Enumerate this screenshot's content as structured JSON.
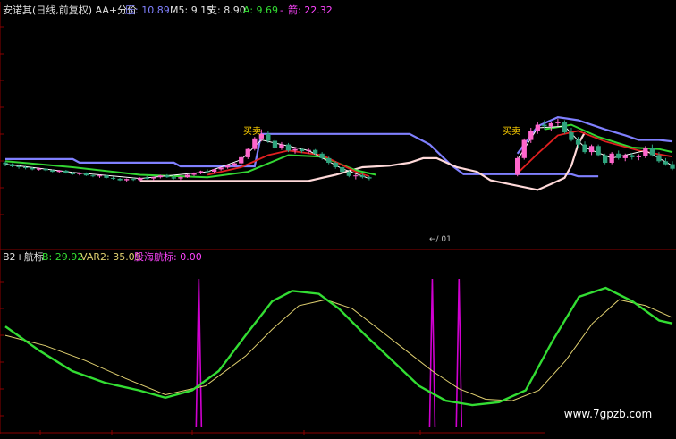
{
  "colors": {
    "bg": "#000000",
    "grid": "#8a0000",
    "up": "#ff66cc",
    "down": "#2fa37d",
    "ma5": "#ffffff",
    "ma_red": "#e02020",
    "ma_green": "#33d633",
    "resist": "#8080ff",
    "support": "#ffd9d9",
    "b_line": "#33dd33",
    "var2_line": "#e0d070",
    "signal": "#d000d0",
    "label_white": "#e0e0e0",
    "label_blue": "#8080ff",
    "label_yellow": "#e0d070",
    "label_green": "#33dd33",
    "label_magenta": "#ff44ff"
  },
  "upper_header": {
    "title": "安诺其(日线,前复权) AA+分价",
    "ya_label": "压: 10.89",
    "m5_label": "M5: 9.15",
    "zhi_label": "支: 8.90",
    "a_label": "A: 9.69",
    "dash": "-",
    "jian_label": "箭: 22.32"
  },
  "lower_header": {
    "title": "B2+航标",
    "b_label": "B: 29.92",
    "var2_label": "VAR2: 35.09",
    "signal_label": "股海航标: 0.00"
  },
  "annotations": {
    "buy1": "买卖",
    "buy2": "买卖",
    "arrow_label": "←/.01"
  },
  "watermark": "www.7gpzb.com",
  "chart_data": [
    {
      "type": "candlestick",
      "panel": "upper",
      "title": "安诺其(日线,前复权) AA+分价",
      "ylim": [
        7.8,
        11.4
      ],
      "x_count": 100,
      "candles": [
        [
          0,
          9.1,
          9.15,
          8.98,
          9.05
        ],
        [
          1,
          9.05,
          9.08,
          8.95,
          8.98
        ],
        [
          2,
          8.98,
          9.02,
          8.9,
          8.95
        ],
        [
          3,
          8.95,
          9.0,
          8.88,
          8.92
        ],
        [
          4,
          8.92,
          8.96,
          8.85,
          8.88
        ],
        [
          5,
          8.88,
          8.94,
          8.84,
          8.9
        ],
        [
          6,
          8.9,
          8.92,
          8.82,
          8.85
        ],
        [
          7,
          8.85,
          8.88,
          8.78,
          8.8
        ],
        [
          8,
          8.8,
          8.86,
          8.76,
          8.84
        ],
        [
          9,
          8.84,
          8.86,
          8.74,
          8.76
        ],
        [
          10,
          8.76,
          8.8,
          8.7,
          8.72
        ],
        [
          11,
          8.72,
          8.78,
          8.68,
          8.75
        ],
        [
          12,
          8.75,
          8.78,
          8.66,
          8.68
        ],
        [
          13,
          8.68,
          8.72,
          8.62,
          8.65
        ],
        [
          14,
          8.65,
          8.7,
          8.6,
          8.68
        ],
        [
          15,
          8.68,
          8.7,
          8.58,
          8.6
        ],
        [
          16,
          8.6,
          8.64,
          8.54,
          8.57
        ],
        [
          17,
          8.57,
          8.6,
          8.5,
          8.52
        ],
        [
          18,
          8.52,
          8.58,
          8.48,
          8.56
        ],
        [
          19,
          8.56,
          8.6,
          8.5,
          8.53
        ],
        [
          20,
          8.53,
          8.62,
          8.5,
          8.6
        ],
        [
          21,
          8.6,
          8.66,
          8.55,
          8.58
        ],
        [
          22,
          8.58,
          8.64,
          8.52,
          8.62
        ],
        [
          23,
          8.62,
          8.7,
          8.58,
          8.68
        ],
        [
          24,
          8.68,
          8.72,
          8.6,
          8.62
        ],
        [
          25,
          8.62,
          8.68,
          8.55,
          8.58
        ],
        [
          26,
          8.58,
          8.64,
          8.52,
          8.62
        ],
        [
          27,
          8.62,
          8.72,
          8.6,
          8.7
        ],
        [
          28,
          8.7,
          8.78,
          8.66,
          8.76
        ],
        [
          29,
          8.76,
          8.84,
          8.72,
          8.82
        ],
        [
          30,
          8.82,
          8.88,
          8.76,
          8.8
        ],
        [
          31,
          8.8,
          8.9,
          8.76,
          8.88
        ],
        [
          32,
          8.88,
          8.96,
          8.84,
          8.94
        ],
        [
          33,
          8.94,
          9.02,
          8.9,
          9.0
        ],
        [
          34,
          9.0,
          9.1,
          8.96,
          9.08
        ],
        [
          35,
          9.08,
          9.3,
          9.05,
          9.28
        ],
        [
          36,
          9.28,
          9.6,
          9.22,
          9.55
        ],
        [
          37,
          9.55,
          9.95,
          9.5,
          9.9
        ],
        [
          38,
          9.9,
          10.2,
          9.8,
          10.05
        ],
        [
          39,
          10.05,
          10.15,
          9.75,
          9.82
        ],
        [
          40,
          9.82,
          9.9,
          9.55,
          9.6
        ],
        [
          41,
          9.6,
          9.78,
          9.52,
          9.7
        ],
        [
          42,
          9.7,
          9.75,
          9.45,
          9.5
        ],
        [
          43,
          9.5,
          9.62,
          9.4,
          9.55
        ],
        [
          44,
          9.55,
          9.6,
          9.42,
          9.48
        ],
        [
          45,
          9.48,
          9.58,
          9.4,
          9.52
        ],
        [
          46,
          9.52,
          9.55,
          9.35,
          9.4
        ],
        [
          47,
          9.4,
          9.45,
          9.2,
          9.25
        ],
        [
          48,
          9.25,
          9.3,
          9.05,
          9.1
        ],
        [
          49,
          9.1,
          9.15,
          8.9,
          8.95
        ],
        [
          50,
          8.95,
          9.0,
          8.75,
          8.8
        ],
        [
          51,
          8.8,
          8.85,
          8.62,
          8.66
        ],
        [
          52,
          8.66,
          8.72,
          8.55,
          8.68
        ],
        [
          53,
          8.68,
          8.74,
          8.58,
          8.62
        ],
        [
          54,
          8.62,
          8.66,
          8.52,
          8.58
        ],
        [
          76,
          8.7,
          9.3,
          8.65,
          9.25
        ],
        [
          77,
          9.25,
          9.9,
          9.2,
          9.85
        ],
        [
          78,
          9.85,
          10.25,
          9.75,
          10.15
        ],
        [
          79,
          10.15,
          10.45,
          10.05,
          10.35
        ],
        [
          80,
          10.35,
          10.5,
          10.2,
          10.3
        ],
        [
          81,
          10.3,
          10.45,
          10.15,
          10.4
        ],
        [
          82,
          10.4,
          10.55,
          10.3,
          10.45
        ],
        [
          83,
          10.45,
          10.5,
          10.05,
          10.1
        ],
        [
          84,
          10.1,
          10.25,
          9.8,
          9.85
        ],
        [
          85,
          9.85,
          9.95,
          9.6,
          9.7
        ],
        [
          86,
          9.7,
          9.8,
          9.4,
          9.45
        ],
        [
          87,
          9.45,
          9.7,
          9.35,
          9.65
        ],
        [
          88,
          9.65,
          9.7,
          9.3,
          9.35
        ],
        [
          89,
          9.35,
          9.4,
          9.05,
          9.1
        ],
        [
          90,
          9.1,
          9.45,
          9.05,
          9.4
        ],
        [
          91,
          9.4,
          9.5,
          9.2,
          9.25
        ],
        [
          92,
          9.25,
          9.4,
          9.15,
          9.35
        ],
        [
          93,
          9.35,
          9.42,
          9.2,
          9.28
        ],
        [
          94,
          9.28,
          9.38,
          9.18,
          9.32
        ],
        [
          95,
          9.32,
          9.65,
          9.25,
          9.6
        ],
        [
          96,
          9.6,
          9.7,
          9.3,
          9.35
        ],
        [
          97,
          9.35,
          9.45,
          9.1,
          9.15
        ],
        [
          98,
          9.15,
          9.25,
          9.0,
          9.05
        ],
        [
          99,
          9.05,
          9.15,
          8.85,
          8.9
        ]
      ],
      "resistance": [
        [
          0,
          9.22
        ],
        [
          10,
          9.22
        ],
        [
          11,
          9.1
        ],
        [
          25,
          9.1
        ],
        [
          26,
          8.98
        ],
        [
          37,
          8.98
        ],
        [
          38,
          10.05
        ],
        [
          60,
          10.05
        ],
        [
          63,
          9.7
        ],
        [
          66,
          9.05
        ],
        [
          68,
          8.72
        ],
        [
          84,
          8.72
        ],
        [
          85,
          8.65
        ],
        [
          88,
          8.65
        ],
        [
          76,
          9.4
        ],
        [
          79,
          10.3
        ],
        [
          82,
          10.6
        ],
        [
          85,
          10.5
        ],
        [
          89,
          10.2
        ],
        [
          92,
          10.0
        ],
        [
          94,
          9.85
        ],
        [
          97,
          9.85
        ],
        [
          99,
          9.8
        ]
      ],
      "support": [
        [
          20,
          8.5
        ],
        [
          45,
          8.5
        ],
        [
          49,
          8.7
        ],
        [
          53,
          8.95
        ],
        [
          57,
          9.0
        ],
        [
          60,
          9.1
        ],
        [
          62,
          9.25
        ],
        [
          64,
          9.25
        ],
        [
          67,
          8.95
        ],
        [
          70,
          8.8
        ],
        [
          72,
          8.52
        ],
        [
          79,
          8.2
        ],
        [
          81,
          8.4
        ],
        [
          83,
          8.6
        ],
        [
          84,
          9.0
        ],
        [
          85,
          9.7
        ],
        [
          86,
          10.1
        ]
      ],
      "ma_white": [
        [
          0,
          9.05
        ],
        [
          10,
          8.78
        ],
        [
          20,
          8.58
        ],
        [
          30,
          8.8
        ],
        [
          35,
          9.2
        ],
        [
          38,
          9.85
        ],
        [
          41,
          9.7
        ],
        [
          45,
          9.5
        ],
        [
          50,
          8.9
        ],
        [
          54,
          8.58
        ],
        [
          76,
          9.2
        ],
        [
          79,
          10.25
        ],
        [
          83,
          10.3
        ],
        [
          86,
          9.6
        ],
        [
          90,
          9.25
        ],
        [
          95,
          9.5
        ],
        [
          99,
          9.0
        ]
      ],
      "ma_red": [
        [
          30,
          8.7
        ],
        [
          35,
          8.95
        ],
        [
          39,
          9.35
        ],
        [
          42,
          9.5
        ],
        [
          47,
          9.35
        ],
        [
          52,
          8.8
        ],
        [
          54,
          8.65
        ],
        [
          76,
          8.75
        ],
        [
          79,
          9.4
        ],
        [
          82,
          10.0
        ],
        [
          85,
          10.15
        ],
        [
          89,
          9.8
        ],
        [
          94,
          9.5
        ],
        [
          99,
          9.3
        ]
      ],
      "ma_green": [
        [
          0,
          9.15
        ],
        [
          10,
          8.95
        ],
        [
          20,
          8.7
        ],
        [
          30,
          8.62
        ],
        [
          36,
          8.8
        ],
        [
          42,
          9.35
        ],
        [
          47,
          9.3
        ],
        [
          52,
          8.85
        ],
        [
          55,
          8.7
        ],
        [
          80,
          10.2
        ],
        [
          84,
          10.35
        ],
        [
          88,
          9.95
        ],
        [
          93,
          9.6
        ],
        [
          97,
          9.55
        ],
        [
          99,
          9.45
        ]
      ]
    },
    {
      "type": "line",
      "panel": "lower",
      "title": "B2+航标",
      "ylim": [
        0,
        100
      ],
      "series": [
        {
          "name": "B",
          "points": [
            [
              0,
              68
            ],
            [
              5,
              52
            ],
            [
              10,
              38
            ],
            [
              15,
              30
            ],
            [
              20,
              25
            ],
            [
              24,
              20
            ],
            [
              28,
              25
            ],
            [
              32,
              38
            ],
            [
              36,
              62
            ],
            [
              40,
              85
            ],
            [
              43,
              92
            ],
            [
              47,
              90
            ],
            [
              50,
              80
            ],
            [
              54,
              62
            ],
            [
              58,
              45
            ],
            [
              62,
              28
            ],
            [
              66,
              18
            ],
            [
              70,
              15
            ],
            [
              74,
              17
            ],
            [
              78,
              25
            ],
            [
              82,
              58
            ],
            [
              86,
              88
            ],
            [
              90,
              94
            ],
            [
              94,
              85
            ],
            [
              98,
              72
            ],
            [
              100,
              70
            ]
          ]
        },
        {
          "name": "VAR2",
          "points": [
            [
              0,
              62
            ],
            [
              6,
              55
            ],
            [
              12,
              45
            ],
            [
              18,
              33
            ],
            [
              24,
              22
            ],
            [
              30,
              28
            ],
            [
              36,
              48
            ],
            [
              40,
              66
            ],
            [
              44,
              82
            ],
            [
              48,
              86
            ],
            [
              52,
              80
            ],
            [
              56,
              66
            ],
            [
              60,
              52
            ],
            [
              64,
              38
            ],
            [
              68,
              26
            ],
            [
              72,
              19
            ],
            [
              76,
              18
            ],
            [
              80,
              25
            ],
            [
              84,
              45
            ],
            [
              88,
              70
            ],
            [
              92,
              86
            ],
            [
              96,
              82
            ],
            [
              100,
              74
            ]
          ]
        },
        {
          "name": "股海航标",
          "spikes": [
            29,
            64,
            68
          ]
        }
      ]
    }
  ]
}
